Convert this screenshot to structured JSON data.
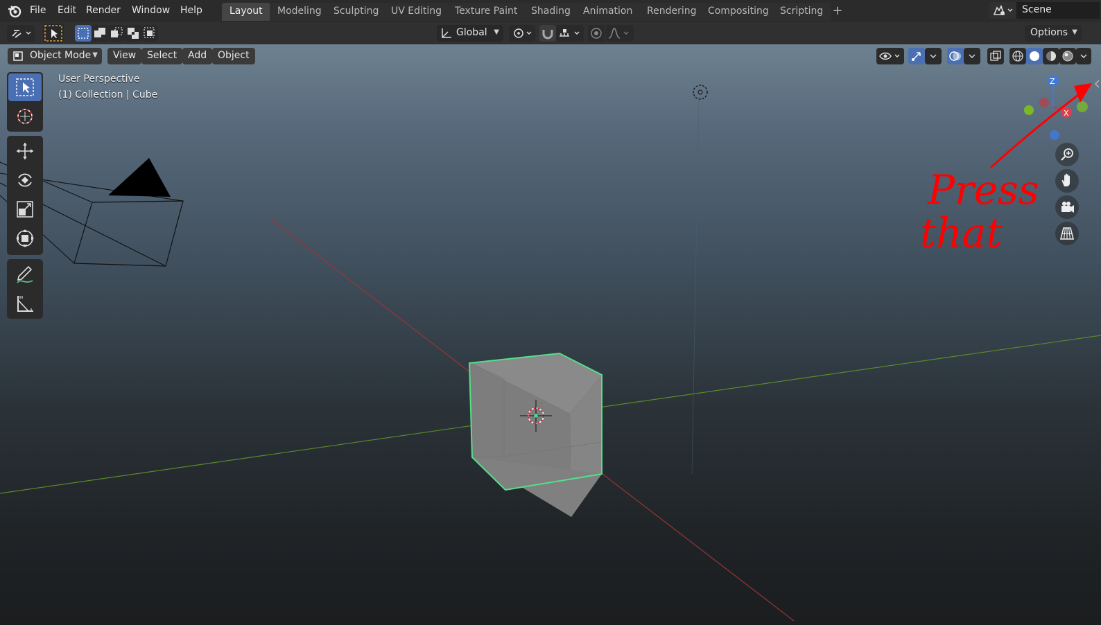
{
  "menubar": {
    "items": [
      "File",
      "Edit",
      "Render",
      "Window",
      "Help"
    ],
    "workspaces": [
      "Layout",
      "Modeling",
      "Sculpting",
      "UV Editing",
      "Texture Paint",
      "Shading",
      "Animation",
      "Rendering",
      "Compositing",
      "Scripting"
    ],
    "active_workspace": "Layout",
    "add_workspace_label": "+",
    "scene_label": "Scene"
  },
  "tool_header": {
    "transform_orientation": "Global",
    "options_label": "Options"
  },
  "viewport_header": {
    "mode_label": "Object Mode",
    "menus": [
      "View",
      "Select",
      "Add",
      "Object"
    ]
  },
  "viewport": {
    "view_name": "User Perspective",
    "collection_info": "(1) Collection | Cube"
  },
  "gizmo": {
    "z_label": "Z",
    "x_label": "X"
  },
  "annotation": {
    "text_line1": "Press",
    "text_line2": "that",
    "color": "#ff0000"
  },
  "colors": {
    "accent": "#4a6fb3",
    "selection_outline": "#54e08a",
    "x_axis": "#9a3535",
    "y_axis": "#5a8a2a"
  }
}
